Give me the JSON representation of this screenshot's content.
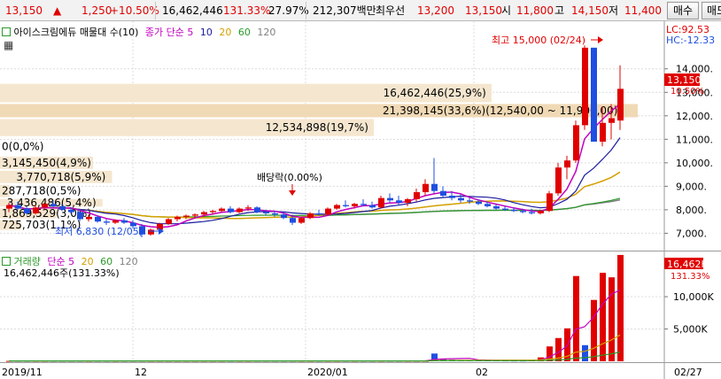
{
  "top_bar": {
    "price": "13,150",
    "change_arrow": "▲",
    "change": "1,250",
    "change_pct": "+10.50%",
    "volume": "16,462,446",
    "volume_ratio": "131.33%",
    "turnover": "27.97%",
    "amount": "212,307백만",
    "best_quote_label": "최우선",
    "best_ask": "13,200",
    "best_bid": "13,150",
    "open_label": "시",
    "open": "11,800",
    "high_label": "고",
    "high": "14,150",
    "low_label": "저",
    "low": "11,400",
    "buy_button": "매수",
    "sell_button": "매도"
  },
  "price_panel": {
    "legend_title": "아이스크림에듀 매물대 수(10)",
    "legend_series_label": "종가 단순",
    "ma_periods": [
      "5",
      "10",
      "20",
      "60",
      "120"
    ],
    "lc_label": "LC:92.53",
    "hc_label": "HC:-12.33",
    "current_price": "13,150",
    "current_pct": "10.50%",
    "high_annotation": "최고 15,000 (02/24)",
    "low_annotation": "최저 6,830 (12/05)",
    "dividend_annotation": "배당락(0.00%)"
  },
  "volume_panel": {
    "legend_title": "거래량",
    "legend_series_label": "단순",
    "ma_periods": [
      "5",
      "20",
      "60",
      "120"
    ],
    "volume_text": "16,462,446주(131.33%)",
    "current_volume": "16,462K",
    "current_pct": "131.33%"
  },
  "x_axis_labels": [
    "2019/11",
    "12",
    "2020/01",
    "02",
    "02/27"
  ],
  "colors": {
    "up": "#e00000",
    "down": "#1f4fe0",
    "ma5": "#c000c0",
    "ma10": "#1a1aa0",
    "ma20": "#d4a000",
    "ma60": "#2a9a2a",
    "ma120": "#808080",
    "volume_profile": "#f5e6cf",
    "volume_profile_max": "#f0d9b5"
  },
  "chart_data": [
    {
      "type": "candlestick",
      "title": "아이스크림에듀 매물대 수(10)",
      "y_ticks": [
        7000,
        8000,
        9000,
        10000,
        11000,
        12000,
        13000,
        14000
      ],
      "ylim": [
        6300,
        15800
      ],
      "x_tick_labels": [
        "2019/11",
        "12",
        "2020/01",
        "02",
        "02/27"
      ],
      "grid": true,
      "candles": [
        {
          "o": 8050,
          "h": 8300,
          "l": 7900,
          "c": 8200
        },
        {
          "o": 8200,
          "h": 8350,
          "l": 8000,
          "c": 8050
        },
        {
          "o": 8050,
          "h": 8150,
          "l": 7800,
          "c": 7850
        },
        {
          "o": 7850,
          "h": 8200,
          "l": 7800,
          "c": 8100
        },
        {
          "o": 8100,
          "h": 8300,
          "l": 8000,
          "c": 8250
        },
        {
          "o": 8250,
          "h": 8400,
          "l": 8100,
          "c": 8150
        },
        {
          "o": 8150,
          "h": 8250,
          "l": 7950,
          "c": 8000
        },
        {
          "o": 8000,
          "h": 8100,
          "l": 7850,
          "c": 7900
        },
        {
          "o": 7900,
          "h": 8050,
          "l": 7500,
          "c": 7600
        },
        {
          "o": 7600,
          "h": 7800,
          "l": 7500,
          "c": 7700
        },
        {
          "o": 7700,
          "h": 7750,
          "l": 7450,
          "c": 7500
        },
        {
          "o": 7500,
          "h": 7600,
          "l": 7350,
          "c": 7450
        },
        {
          "o": 7450,
          "h": 7600,
          "l": 7400,
          "c": 7550
        },
        {
          "o": 7550,
          "h": 7650,
          "l": 7400,
          "c": 7450
        },
        {
          "o": 7450,
          "h": 7550,
          "l": 7200,
          "c": 7300
        },
        {
          "o": 7300,
          "h": 7400,
          "l": 6830,
          "c": 6950
        },
        {
          "o": 6950,
          "h": 7200,
          "l": 6900,
          "c": 7150
        },
        {
          "o": 7150,
          "h": 7450,
          "l": 7100,
          "c": 7400
        },
        {
          "o": 7400,
          "h": 7650,
          "l": 7350,
          "c": 7600
        },
        {
          "o": 7600,
          "h": 7750,
          "l": 7500,
          "c": 7700
        },
        {
          "o": 7700,
          "h": 7800,
          "l": 7600,
          "c": 7750
        },
        {
          "o": 7750,
          "h": 7850,
          "l": 7650,
          "c": 7800
        },
        {
          "o": 7800,
          "h": 7950,
          "l": 7700,
          "c": 7900
        },
        {
          "o": 7900,
          "h": 8000,
          "l": 7800,
          "c": 7950
        },
        {
          "o": 7950,
          "h": 8100,
          "l": 7900,
          "c": 8050
        },
        {
          "o": 8050,
          "h": 8150,
          "l": 7850,
          "c": 7900
        },
        {
          "o": 7900,
          "h": 8100,
          "l": 7850,
          "c": 8050
        },
        {
          "o": 8050,
          "h": 8200,
          "l": 7950,
          "c": 8100
        },
        {
          "o": 8100,
          "h": 8150,
          "l": 7850,
          "c": 7900
        },
        {
          "o": 7900,
          "h": 8000,
          "l": 7750,
          "c": 7850
        },
        {
          "o": 7850,
          "h": 7950,
          "l": 7700,
          "c": 7800
        },
        {
          "o": 7800,
          "h": 7900,
          "l": 7600,
          "c": 7650
        },
        {
          "o": 7650,
          "h": 7800,
          "l": 7350,
          "c": 7450
        },
        {
          "o": 7450,
          "h": 7700,
          "l": 7400,
          "c": 7650
        },
        {
          "o": 7650,
          "h": 7900,
          "l": 7600,
          "c": 7850
        },
        {
          "o": 7850,
          "h": 8000,
          "l": 7750,
          "c": 7800
        },
        {
          "o": 7800,
          "h": 8100,
          "l": 7750,
          "c": 8050
        },
        {
          "o": 8050,
          "h": 8250,
          "l": 8000,
          "c": 8200
        },
        {
          "o": 8200,
          "h": 8400,
          "l": 8100,
          "c": 8150
        },
        {
          "o": 8150,
          "h": 8300,
          "l": 8050,
          "c": 8250
        },
        {
          "o": 8250,
          "h": 8450,
          "l": 8150,
          "c": 8200
        },
        {
          "o": 8200,
          "h": 8350,
          "l": 8050,
          "c": 8100
        },
        {
          "o": 8100,
          "h": 8600,
          "l": 8050,
          "c": 8500
        },
        {
          "o": 8500,
          "h": 8700,
          "l": 8300,
          "c": 8400
        },
        {
          "o": 8400,
          "h": 8600,
          "l": 8200,
          "c": 8300
        },
        {
          "o": 8300,
          "h": 8500,
          "l": 8150,
          "c": 8450
        },
        {
          "o": 8450,
          "h": 8900,
          "l": 8350,
          "c": 8750
        },
        {
          "o": 8750,
          "h": 9300,
          "l": 8600,
          "c": 9100
        },
        {
          "o": 9100,
          "h": 10200,
          "l": 8700,
          "c": 8800
        },
        {
          "o": 8800,
          "h": 9000,
          "l": 8500,
          "c": 8600
        },
        {
          "o": 8600,
          "h": 8800,
          "l": 8400,
          "c": 8500
        },
        {
          "o": 8500,
          "h": 8650,
          "l": 8300,
          "c": 8400
        },
        {
          "o": 8400,
          "h": 8500,
          "l": 8250,
          "c": 8350
        },
        {
          "o": 8350,
          "h": 8450,
          "l": 8200,
          "c": 8250
        },
        {
          "o": 8250,
          "h": 8350,
          "l": 8100,
          "c": 8150
        },
        {
          "o": 8150,
          "h": 8250,
          "l": 8000,
          "c": 8050
        },
        {
          "o": 8050,
          "h": 8150,
          "l": 7950,
          "c": 8000
        },
        {
          "o": 8000,
          "h": 8100,
          "l": 7900,
          "c": 7950
        },
        {
          "o": 7950,
          "h": 8050,
          "l": 7850,
          "c": 7900
        },
        {
          "o": 7900,
          "h": 8050,
          "l": 7800,
          "c": 7850
        },
        {
          "o": 7850,
          "h": 8000,
          "l": 7800,
          "c": 7950
        },
        {
          "o": 7950,
          "h": 8800,
          "l": 7900,
          "c": 8700
        },
        {
          "o": 8700,
          "h": 10000,
          "l": 8600,
          "c": 9800
        },
        {
          "o": 9800,
          "h": 10300,
          "l": 9300,
          "c": 10100
        },
        {
          "o": 10100,
          "h": 11800,
          "l": 10000,
          "c": 11600
        },
        {
          "o": 11600,
          "h": 15000,
          "l": 11400,
          "c": 14900
        },
        {
          "o": 14900,
          "h": 14900,
          "l": 11500,
          "c": 10900
        },
        {
          "o": 10900,
          "h": 12400,
          "l": 10700,
          "c": 11700
        },
        {
          "o": 11700,
          "h": 12500,
          "l": 11000,
          "c": 11900
        },
        {
          "o": 11800,
          "h": 14150,
          "l": 11400,
          "c": 13150
        }
      ],
      "moving_averages": [
        {
          "period": 5,
          "end_value": 12400
        },
        {
          "period": 10,
          "end_value": 10200
        },
        {
          "period": 20,
          "end_value": 9200
        },
        {
          "period": 60,
          "end_value": 8300
        },
        {
          "period": 120,
          "end_value": 8200
        }
      ],
      "volume_profile": [
        {
          "price_low": 12540,
          "price_high": 13400,
          "volume": 16462446,
          "pct": 25.9,
          "label": "16,462,446(25,9%)"
        },
        {
          "price_low": 11900,
          "price_high": 12540,
          "volume": 21398145,
          "pct": 33.6,
          "label": "21,398,145(33,6%)(12,540,00 ~ 11,900,00)"
        },
        {
          "price_low": 11100,
          "price_high": 11900,
          "volume": 12534898,
          "pct": 19.7,
          "label": "12,534,898(19,7%)"
        },
        {
          "price_low": 10300,
          "price_high": 11100,
          "volume": 0,
          "pct": 0.0,
          "label": "0(0,0%)"
        },
        {
          "price_low": 9700,
          "price_high": 10300,
          "volume": 3145450,
          "pct": 4.9,
          "label": "3,145,450(4,9%)"
        },
        {
          "price_low": 9100,
          "price_high": 9700,
          "volume": 3770718,
          "pct": 5.9,
          "label": "3,770,718(5,9%)"
        },
        {
          "price_low": 8500,
          "price_high": 9100,
          "volume": 287718,
          "pct": 0.5,
          "label": "287,718(0,5%)"
        },
        {
          "price_low": 8100,
          "price_high": 8500,
          "volume": 3436486,
          "pct": 5.4,
          "label": "3,436,486(5,4%)"
        },
        {
          "price_low": 7600,
          "price_high": 8100,
          "volume": 1869529,
          "pct": 3.0,
          "label": "1,869,529(3,0%)"
        },
        {
          "price_low": 7100,
          "price_high": 7600,
          "volume": 725703,
          "pct": 1.1,
          "label": "725,703(1,1%)"
        }
      ]
    },
    {
      "type": "bar",
      "title": "거래량",
      "y_ticks": [
        5000,
        10000
      ],
      "y_tick_labels": [
        "5,000K",
        "10,000K"
      ],
      "ylim": [
        0,
        17000
      ],
      "unit": "K",
      "values": [
        60,
        60,
        60,
        60,
        60,
        60,
        60,
        60,
        60,
        60,
        60,
        60,
        60,
        60,
        60,
        60,
        60,
        60,
        60,
        60,
        60,
        60,
        60,
        60,
        60,
        60,
        60,
        60,
        60,
        60,
        60,
        60,
        60,
        60,
        60,
        60,
        60,
        60,
        60,
        60,
        60,
        60,
        60,
        60,
        60,
        60,
        60,
        60,
        1200,
        400,
        250,
        200,
        180,
        160,
        150,
        140,
        130,
        120,
        120,
        150,
        600,
        2300,
        3600,
        5100,
        13200,
        2500,
        9500,
        13700,
        13000,
        16462
      ],
      "up_days": [
        true,
        false,
        false,
        true,
        true,
        false,
        false,
        false,
        false,
        true,
        false,
        false,
        true,
        false,
        false,
        false,
        true,
        true,
        true,
        true,
        true,
        true,
        true,
        true,
        true,
        false,
        true,
        true,
        false,
        false,
        false,
        false,
        false,
        true,
        true,
        false,
        true,
        true,
        false,
        true,
        false,
        false,
        true,
        false,
        false,
        true,
        true,
        true,
        false,
        false,
        false,
        false,
        false,
        false,
        false,
        false,
        false,
        false,
        false,
        true,
        true,
        true,
        true,
        true,
        true,
        false,
        true,
        true,
        true,
        true
      ]
    }
  ]
}
